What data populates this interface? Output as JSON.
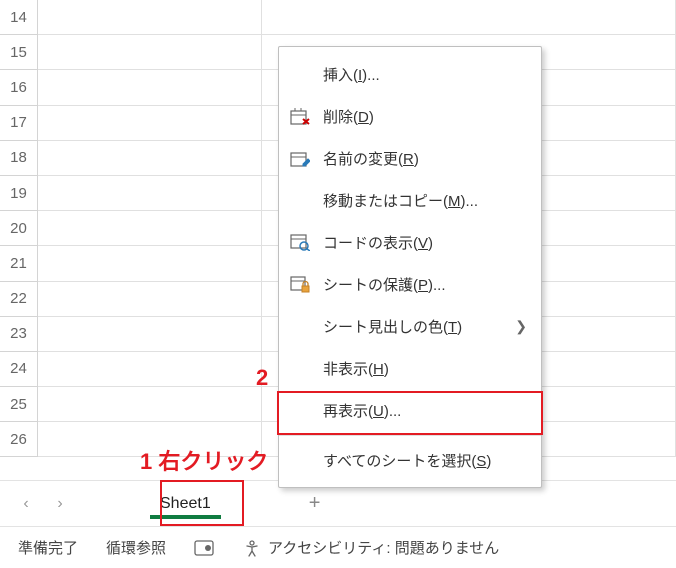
{
  "rows": [
    14,
    15,
    16,
    17,
    18,
    19,
    20,
    21,
    22,
    23,
    24,
    25,
    26
  ],
  "sheetTab": "Sheet1",
  "annotations": {
    "a1": "1 右クリック",
    "a2": "2"
  },
  "contextMenu": {
    "insert": {
      "text": "挿入(",
      "key": "I",
      "suffix": ")..."
    },
    "delete": {
      "text": "削除(",
      "key": "D",
      "suffix": ")"
    },
    "rename": {
      "text": "名前の変更(",
      "key": "R",
      "suffix": ")"
    },
    "move": {
      "text": "移動またはコピー(",
      "key": "M",
      "suffix": ")..."
    },
    "viewcode": {
      "text": "コードの表示(",
      "key": "V",
      "suffix": ")"
    },
    "protect": {
      "text": "シートの保護(",
      "key": "P",
      "suffix": ")..."
    },
    "tabcolor": {
      "text": "シート見出しの色(",
      "key": "T",
      "suffix": ")"
    },
    "hide": {
      "text": "非表示(",
      "key": "H",
      "suffix": ")"
    },
    "unhide": {
      "text": "再表示(",
      "key": "U",
      "suffix": ")..."
    },
    "selectall": {
      "text": "すべてのシートを選択(",
      "key": "S",
      "suffix": ")"
    }
  },
  "statusbar": {
    "ready": "準備完了",
    "circular": "循環参照",
    "accessibility": "アクセシビリティ: 問題ありません"
  }
}
